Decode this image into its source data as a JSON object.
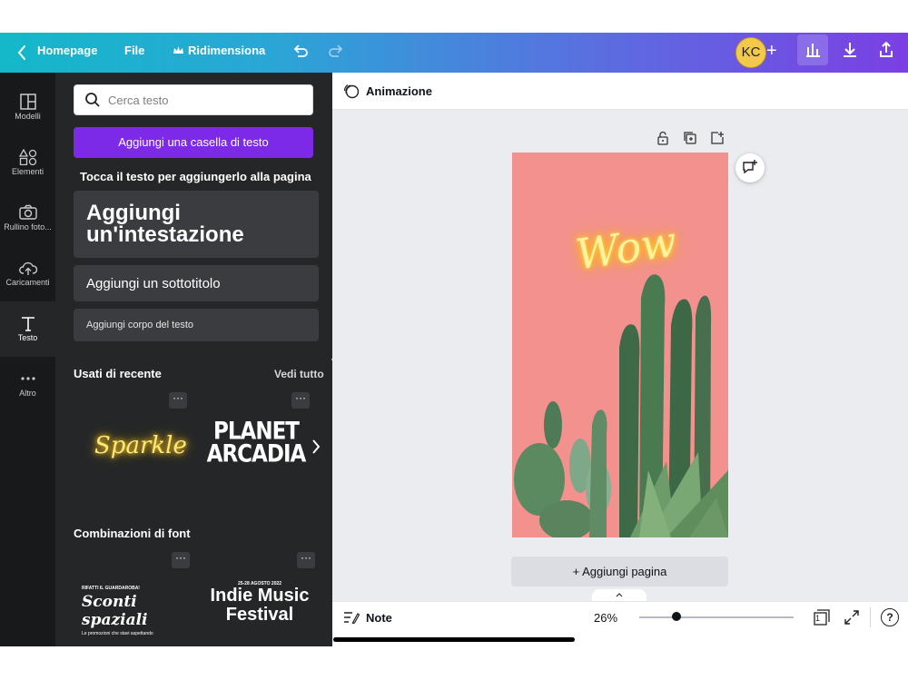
{
  "topbar": {
    "home_label": "Homepage",
    "file_label": "File",
    "resize_label": "Ridimensiona",
    "avatar_initials": "KC"
  },
  "rail": {
    "items": [
      {
        "label": "Modelli",
        "icon": "template-icon"
      },
      {
        "label": "Elementi",
        "icon": "shapes-icon"
      },
      {
        "label": "Rullino foto...",
        "icon": "camera-icon"
      },
      {
        "label": "Caricamenti",
        "icon": "upload-cloud-icon"
      },
      {
        "label": "Testo",
        "icon": "text-icon"
      },
      {
        "label": "Altro",
        "icon": "more-dots-icon"
      }
    ]
  },
  "panel": {
    "search_placeholder": "Cerca testo",
    "add_textbox_label": "Aggiungi una casella di testo",
    "hint": "Tocca il testo per aggiungerlo alla pagina",
    "heading_label": "Aggiungi un'intestazione",
    "subtitle_label": "Aggiungi un sottotitolo",
    "body_label": "Aggiungi corpo del testo",
    "recent_title": "Usati di recente",
    "see_all": "Vedi tutto",
    "recent_items": [
      "Sparkle",
      "PLANET ARCADIA"
    ],
    "combos_title": "Combinazioni di font",
    "combo1": {
      "line1": "RIFATTI IL GUARDAROBA!",
      "line2": "Sconti spaziali",
      "line3": "Le promozioni che stavi aspettando"
    },
    "combo2": {
      "line1": "25-28 AGOSTO 2022",
      "line2": "Indie Music",
      "line3": "Festival"
    }
  },
  "canvas": {
    "animation_label": "Animazione",
    "page_text": "Wow",
    "add_page_label": "+ Aggiungi pagina"
  },
  "bottombar": {
    "notes_label": "Note",
    "zoom": "26%",
    "page_count": "1"
  },
  "colors": {
    "accent": "#7d2ae8",
    "page_bg": "#f3918e",
    "neon": "#ffe873"
  }
}
